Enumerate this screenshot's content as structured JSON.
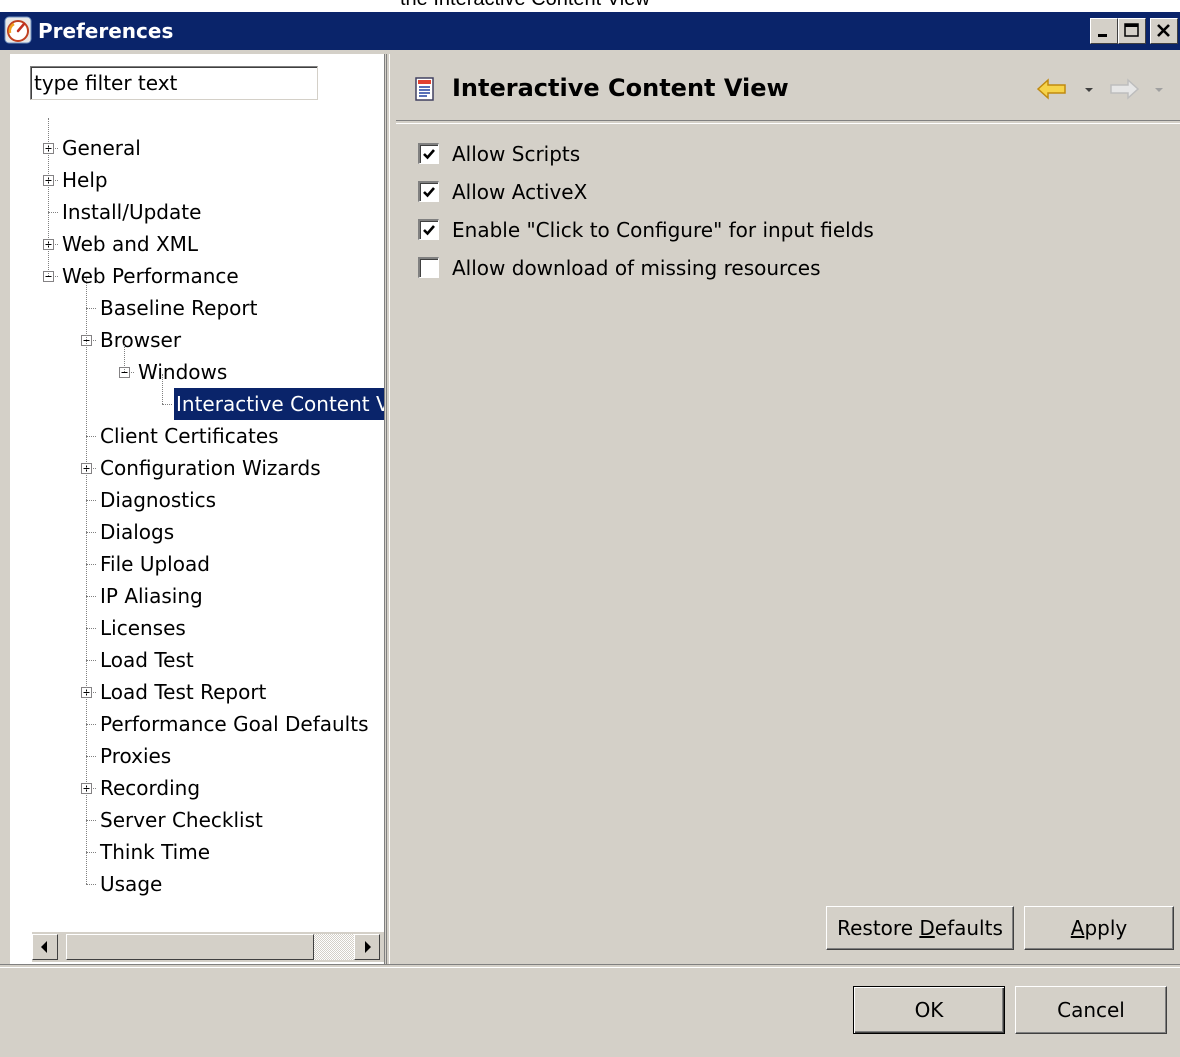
{
  "top_caption": "the Interactive Content View",
  "window": {
    "title": "Preferences",
    "buttons": {
      "minimize": "_",
      "maximize": "□",
      "close": "×"
    }
  },
  "filter": {
    "placeholder": "type filter text",
    "value": ""
  },
  "tree": [
    {
      "label": "General",
      "expander": "plus"
    },
    {
      "label": "Help",
      "expander": "plus"
    },
    {
      "label": "Install/Update",
      "expander": "none"
    },
    {
      "label": "Web and XML",
      "expander": "plus"
    },
    {
      "label": "Web Performance",
      "expander": "minus"
    },
    {
      "label": "Baseline Report",
      "expander": "none"
    },
    {
      "label": "Browser",
      "expander": "minus"
    },
    {
      "label": "Windows",
      "expander": "minus"
    },
    {
      "label": "Interactive Content View",
      "expander": "none",
      "selected": true
    },
    {
      "label": "Client Certificates",
      "expander": "none"
    },
    {
      "label": "Configuration Wizards",
      "expander": "plus"
    },
    {
      "label": "Diagnostics",
      "expander": "none"
    },
    {
      "label": "Dialogs",
      "expander": "none"
    },
    {
      "label": "File Upload",
      "expander": "none"
    },
    {
      "label": "IP Aliasing",
      "expander": "none"
    },
    {
      "label": "Licenses",
      "expander": "none"
    },
    {
      "label": "Load Test",
      "expander": "none"
    },
    {
      "label": "Load Test Report",
      "expander": "plus"
    },
    {
      "label": "Performance Goal Defaults",
      "expander": "none"
    },
    {
      "label": "Proxies",
      "expander": "none"
    },
    {
      "label": "Recording",
      "expander": "plus"
    },
    {
      "label": "Server Checklist",
      "expander": "none"
    },
    {
      "label": "Think Time",
      "expander": "none"
    },
    {
      "label": "Usage",
      "expander": "none"
    }
  ],
  "page": {
    "title": "Interactive Content View",
    "options": [
      {
        "label": "Allow Scripts",
        "checked": true
      },
      {
        "label": "Allow ActiveX",
        "checked": true
      },
      {
        "label": "Enable \"Click to Configure\" for input fields",
        "checked": true
      },
      {
        "label": "Allow download of missing resources",
        "checked": false
      }
    ],
    "restore_defaults": {
      "pre": "Restore ",
      "mnemonic": "D",
      "post": "efaults"
    },
    "apply": {
      "pre": "",
      "mnemonic": "A",
      "post": "pply"
    }
  },
  "footer": {
    "ok_label": "OK",
    "cancel_label": "Cancel"
  },
  "colors": {
    "title_bar": "#0a246a",
    "window_bg": "#d4d0c8",
    "selection": "#0a246a",
    "nav_back": "#f0c020"
  },
  "icons": {
    "app": "preferences-gauge-icon",
    "page": "page-document-icon",
    "back": "back-arrow-icon",
    "forward": "forward-arrow-icon"
  }
}
